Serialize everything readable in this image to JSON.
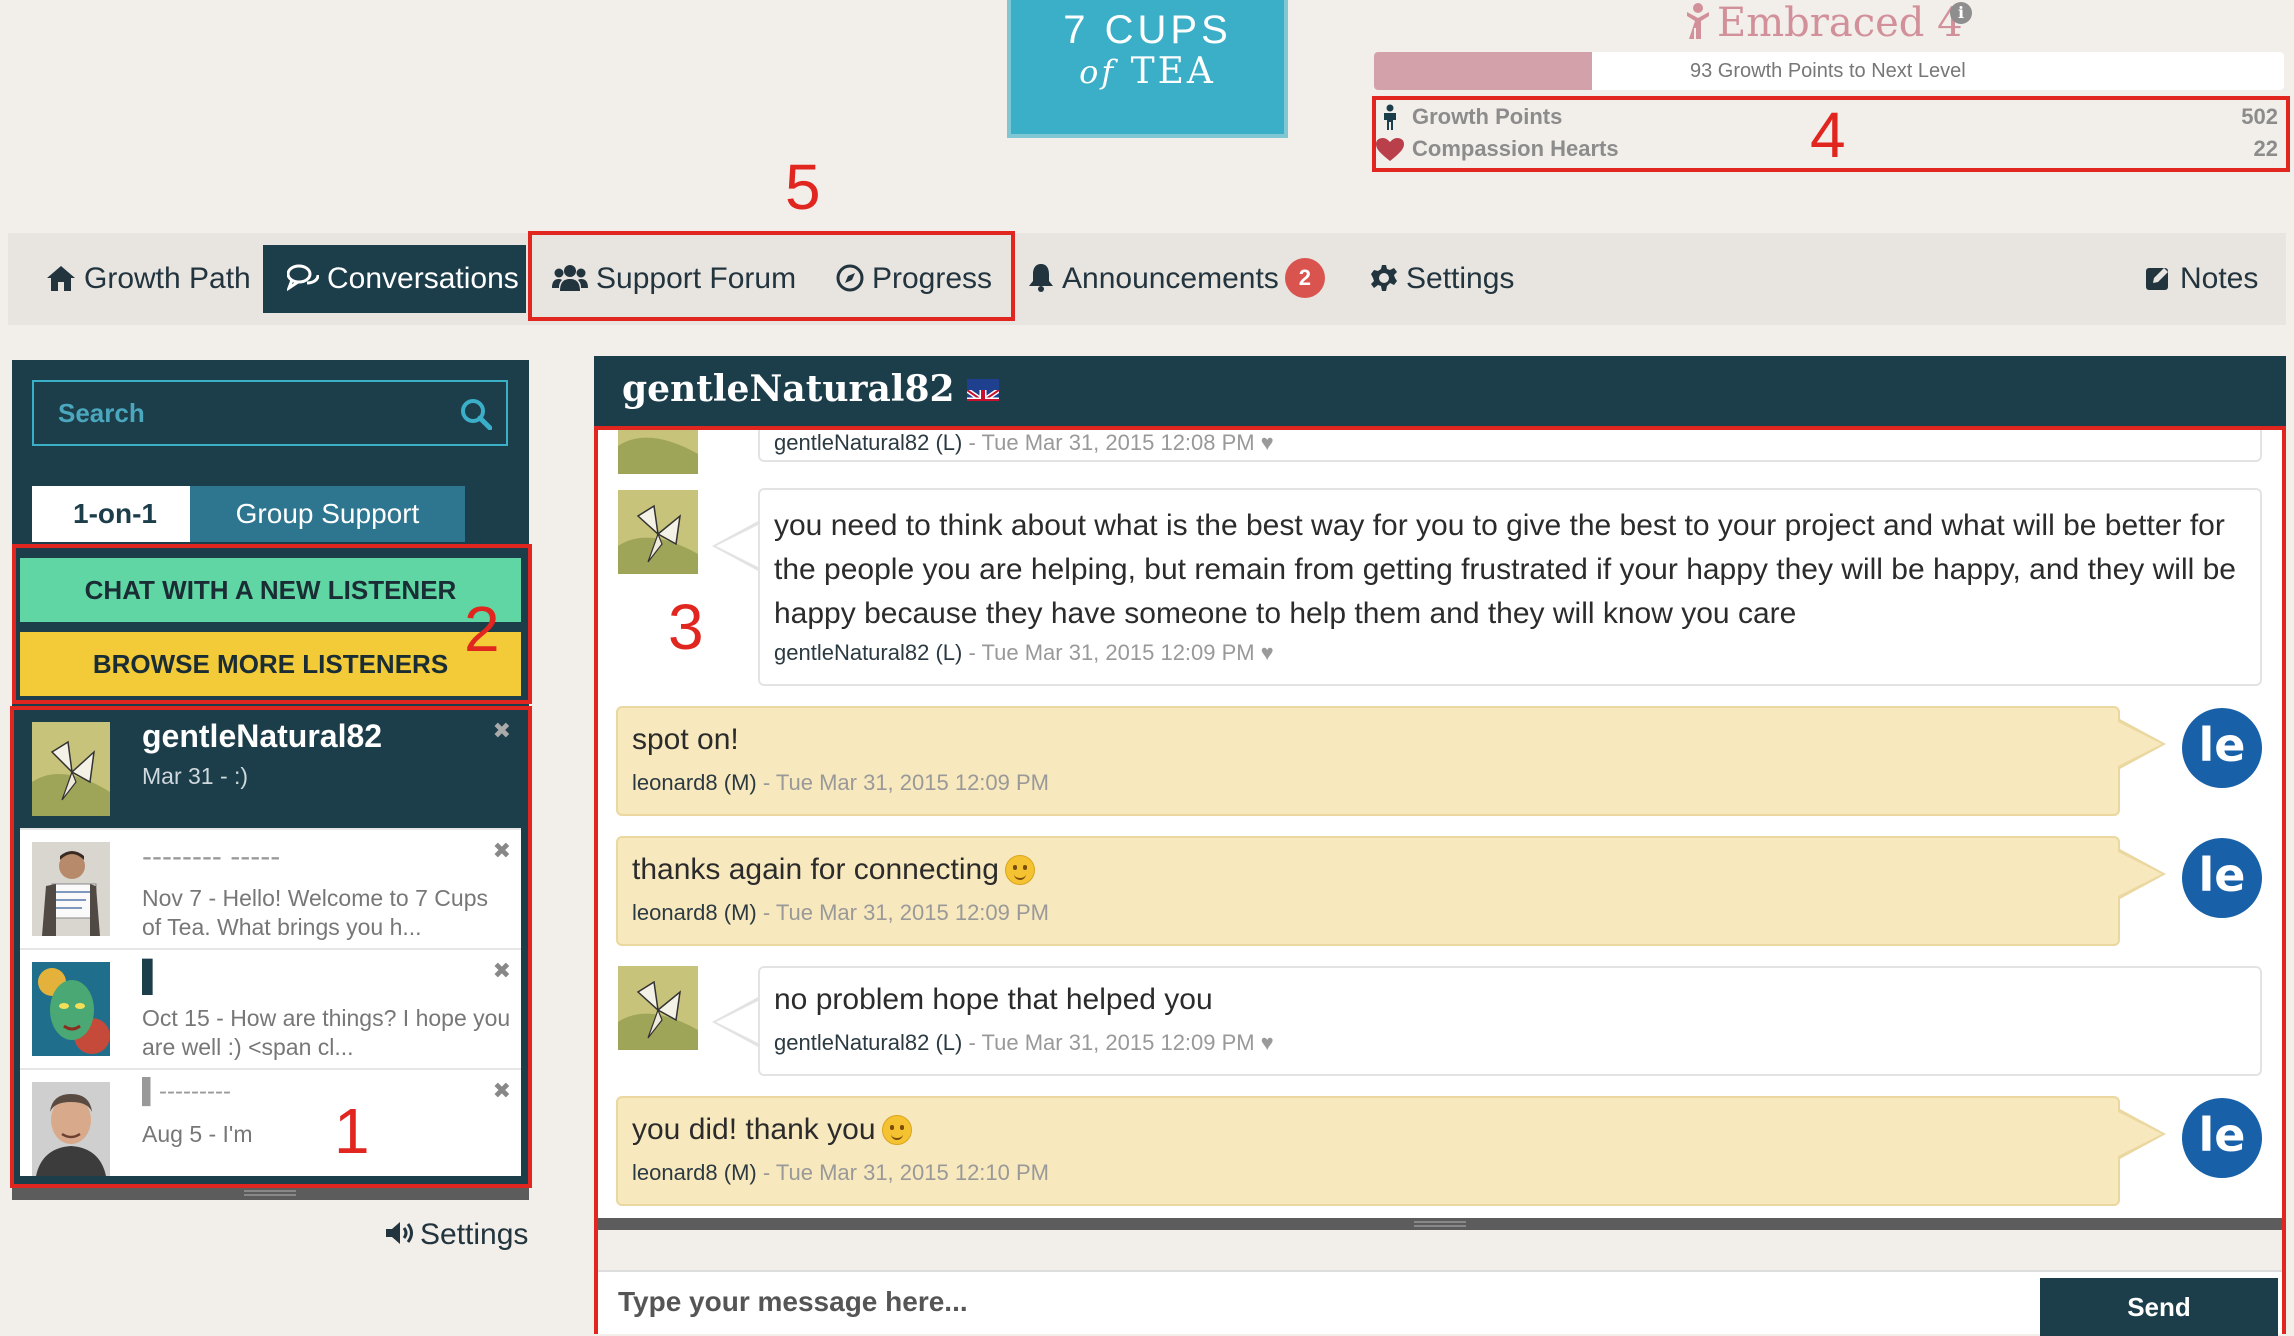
{
  "logo": {
    "line1": "7 CUPS",
    "line2_of": "of",
    "line2_tea": "TEA"
  },
  "level": {
    "label": "Embraced",
    "number": "4",
    "info_icon": "info-icon",
    "progress_text": "93 Growth Points to Next Level",
    "progress_fraction": 0.24
  },
  "stats": {
    "growth_points_label": "Growth Points",
    "growth_points_value": "502",
    "compassion_hearts_label": "Compassion Hearts",
    "compassion_hearts_value": "22"
  },
  "annotations": [
    "1",
    "2",
    "3",
    "4",
    "5"
  ],
  "nav": {
    "growth_path": "Growth Path",
    "conversations": "Conversations",
    "support_forum": "Support Forum",
    "progress": "Progress",
    "announcements": "Announcements",
    "announcements_badge": "2",
    "settings": "Settings",
    "notes": "Notes"
  },
  "sidebar": {
    "search_placeholder": "Search",
    "tab_one_on_one": "1-on-1",
    "tab_group_support": "Group Support",
    "chat_new_listener": "CHAT WITH A NEW LISTENER",
    "browse_listeners": "BROWSE MORE LISTENERS",
    "conversations": [
      {
        "name": "gentleNatural82",
        "preview": "Mar 31 - :)"
      },
      {
        "name": "-------- -----",
        "preview": "Nov 7 - Hello! Welcome to 7 Cups of Tea. What brings you h..."
      },
      {
        "name": "▌",
        "preview": "Oct 15 - How are things? I hope you are well :) <span cl..."
      },
      {
        "name": "▌---------",
        "preview": "Aug 5 - I'm"
      }
    ],
    "settings": "Settings"
  },
  "chat": {
    "partner": "gentleNatural82",
    "messages": [
      {
        "text": "",
        "who": "gentleNatural82 (L)",
        "time": "- Tue Mar 31, 2015 12:08 PM"
      },
      {
        "text": "you need to think about what is the best way for you to give the best to your project and what will be better for the people you are helping, but remain from getting frustrated if your happy they will be happy, and they will be happy because they have someone to help them and they will know you care",
        "who": "gentleNatural82 (L)",
        "time": "- Tue Mar 31, 2015 12:09 PM"
      },
      {
        "text": "spot on!",
        "who": "leonard8 (M)",
        "time": "- Tue Mar 31, 2015 12:09 PM"
      },
      {
        "text": "thanks again for connecting",
        "who": "leonard8 (M)",
        "time": "- Tue Mar 31, 2015 12:09 PM"
      },
      {
        "text": "no problem hope that helped you",
        "who": "gentleNatural82 (L)",
        "time": "- Tue Mar 31, 2015 12:09 PM"
      },
      {
        "text": "you did! thank you",
        "who": "leonard8 (M)",
        "time": "- Tue Mar 31, 2015 12:10 PM"
      }
    ],
    "self_avatar_text": "le",
    "composer_placeholder": "Type your message here...",
    "send_label": "Send"
  },
  "colors": {
    "accent_dark": "#1c3d4a",
    "teal": "#3aafc7",
    "annotation_red": "#e0261f",
    "green_button": "#5fd6a3",
    "yellow_button": "#f3cb38",
    "pink": "#d2909a"
  }
}
